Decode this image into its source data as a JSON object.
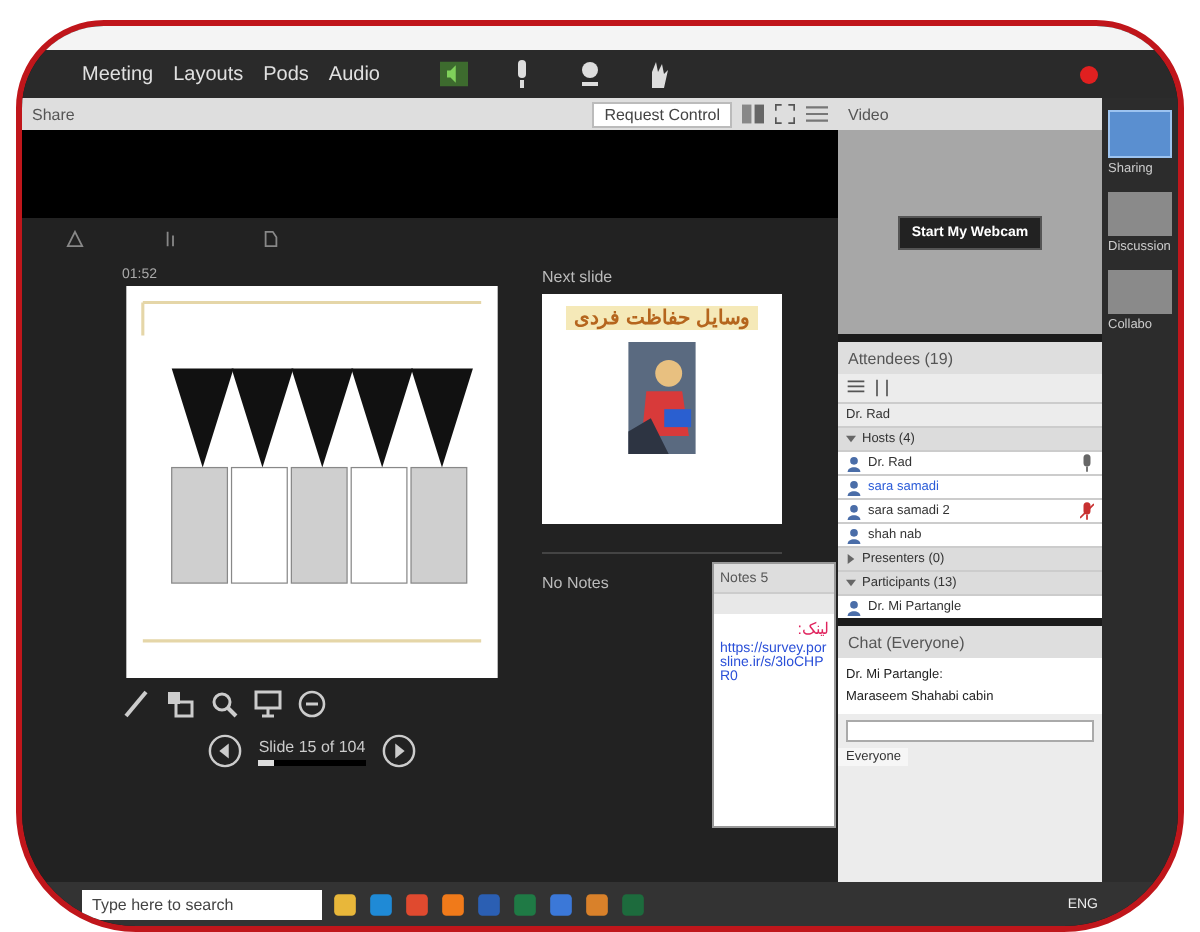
{
  "menu": [
    "Meeting",
    "Layouts",
    "Pods",
    "Audio"
  ],
  "share_pod": {
    "title": "Share",
    "request_button": "Request Control",
    "timer": "01:52",
    "slide_status": "Slide 15 of 104",
    "slide_progress": {
      "level": 0.14
    },
    "next_slide_label": "Next slide",
    "next_slide_title": "وسایل حفاظت فردی",
    "notes_text": "No Notes"
  },
  "video_pod": {
    "title": "Video",
    "webcam_button": "Start My Webcam"
  },
  "layouts": [
    {
      "label": "Sharing",
      "selected": true
    },
    {
      "label": "Discussion",
      "selected": false
    },
    {
      "label": "Collabo",
      "selected": false
    }
  ],
  "notes_pod": {
    "title": "Notes 5",
    "lines": [
      {
        "kind": "label",
        "text": "لینک:"
      },
      {
        "kind": "link",
        "text": "https://survey.porsline.ir/s/3loCHPR0"
      }
    ]
  },
  "attendees": {
    "title": "Attendees (19)",
    "me": "Dr. Rad",
    "groups": [
      {
        "label": "Hosts (4)",
        "expanded": true,
        "members": [
          {
            "name": "Dr. Rad",
            "selected": false,
            "mic_on": true,
            "muted": false
          },
          {
            "name": "sara samadi",
            "selected": true,
            "mic_on": false,
            "muted": false
          },
          {
            "name": "sara samadi 2",
            "selected": false,
            "mic_on": true,
            "muted": true
          },
          {
            "name": "shah nab",
            "selected": false,
            "mic_on": false,
            "muted": false
          }
        ]
      },
      {
        "label": "Presenters (0)",
        "expanded": false
      },
      {
        "label": "Participants (13)",
        "expanded": true,
        "members": [
          {
            "name": "Dr. Mi Partangle",
            "selected": false,
            "mic_on": false,
            "muted": false
          }
        ]
      }
    ]
  },
  "chat": {
    "title": "Chat (Everyone)",
    "messages": [
      {
        "text": "Dr. Mi Partangle:"
      },
      {
        "text": "Maraseem Shahabi cabin"
      }
    ],
    "recipient_tab": "Everyone"
  },
  "taskbar": {
    "search_placeholder": "Type here to search",
    "apps": [
      {
        "color": "#e8b73a"
      },
      {
        "color": "#1f8ad6"
      },
      {
        "color": "#e04a2f"
      },
      {
        "color": "#f07a1a"
      },
      {
        "color": "#2b5fb3"
      },
      {
        "color": "#1f7a45"
      },
      {
        "color": "#3b78d8"
      },
      {
        "color": "#d9812a"
      },
      {
        "color": "#1d6b3d"
      }
    ],
    "language": "ENG"
  }
}
